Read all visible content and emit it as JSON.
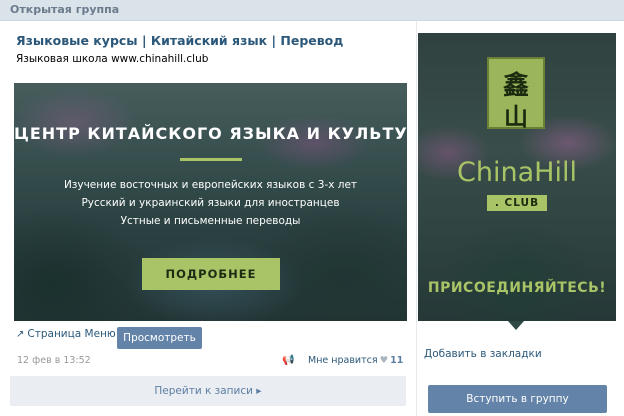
{
  "topbar": {
    "label": "Открытая группа"
  },
  "group": {
    "title": "Языковые курсы | Китайский язык | Перевод",
    "status": "Языковая школа www.chinahill.club"
  },
  "banner": {
    "title": "ЦЕНТР КИТАЙСКОГО ЯЗЫКА И КУЛЬТУРЫ",
    "lines": [
      "Изучение восточных и европейских языков с 3-х лет",
      "Русский и украинский языки для иностранцев",
      "Устные и письменные переводы"
    ],
    "button_label": "ПОДРОБНЕЕ",
    "accent_color": "#a9c466"
  },
  "wiki": {
    "menu_link": "Страница Меню",
    "view_button": "Просмотреть"
  },
  "post": {
    "date": "12 фев в 13:52",
    "like_label": "Мне нравится",
    "like_count": "11",
    "goto_label": "Перейти к записи ▸"
  },
  "sidebar": {
    "ad": {
      "seal_chars": [
        "鑫",
        "山"
      ],
      "brand": "ChinaHill",
      "club": ". CLUB",
      "cta": "ПРИСОЕДИНЯЙТЕСЬ!"
    },
    "bookmark_link": "Добавить в закладки",
    "join_button": "Вступить в группу"
  },
  "colors": {
    "link": "#2b587a",
    "button": "#6383a8",
    "background": "#edeef0"
  }
}
